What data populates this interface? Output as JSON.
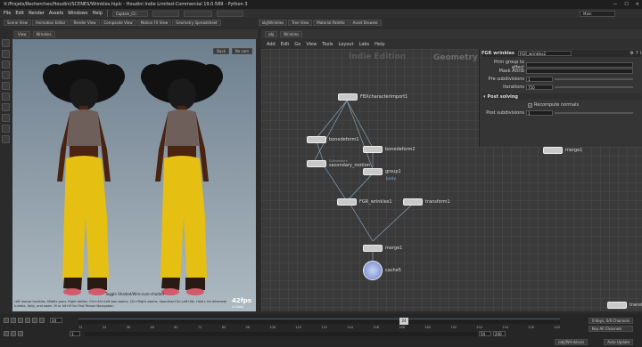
{
  "window": {
    "title": "V:/Projets/Recherches/Houdini/SCENES/Wrinkles.hiplc - Houdini Indie Limited-Commercial 19.0.589 - Python 3"
  },
  "menubar": {
    "items": [
      "File",
      "Edit",
      "Render",
      "Assets",
      "Windows",
      "Help"
    ],
    "desktop_field": "Captain_Ch",
    "desktop_right": "Main"
  },
  "pane_tabs_left": [
    "Scene View",
    "Animation Editor",
    "Render View",
    "Composite View",
    "Motion FX View",
    "Geometry Spreadsheet"
  ],
  "pane_tabs_right": [
    "obj/Wrinkles",
    "Tree View",
    "Material Palette",
    "Asset Browser"
  ],
  "viewport": {
    "tab": "View",
    "path": "Wrinkles",
    "camera": "Back",
    "view_mode": "No cam",
    "status": "Toggle Shaded/Wire-over-shaded",
    "fps": "42fps",
    "fps_sub": "4.54ms",
    "hint1": "Left mouse tumbles. Middle pans. Right dollies. Ctrl+Alt+Left box zooms. Ctrl+Right zooms. Spacebar-Ctrl-Left tilts. Hold L for alternate",
    "hint2": "tumble, dolly, and zoom.    M or Alt+M for First Person Navigation."
  },
  "network": {
    "path": "obj",
    "node": "Wrinkles",
    "menu": [
      "Add",
      "Edit",
      "Go",
      "View",
      "Tools",
      "Layout",
      "Labs",
      "Help"
    ],
    "watermark_left": "Indie Edition",
    "watermark_right": "Geometry",
    "nodes": [
      {
        "label": "FBXcharacterimport1"
      },
      {
        "label": "bonedeform1"
      },
      {
        "label": "bonedeform2"
      },
      {
        "label": "secondary_motion",
        "sub": "Subnetwork"
      },
      {
        "label": "group1",
        "sub": "body"
      },
      {
        "label": "FGR_wrinkles1"
      },
      {
        "label": "transform1"
      },
      {
        "label": "merge1"
      },
      {
        "label": "cache5"
      },
      {
        "label": "merge1"
      },
      {
        "label": "transf"
      }
    ]
  },
  "params": {
    "node_type": "FGR wrinkles",
    "node_name": "FGR_wrinkles2",
    "rows": [
      {
        "label": "Prim group to affect",
        "value": ""
      },
      {
        "label": "Mask Attrib",
        "value": ""
      },
      {
        "label": "Pre subdivisions",
        "value": "1"
      },
      {
        "label": "Iterations",
        "value": "750"
      }
    ],
    "section": "Post solving",
    "checkbox": "Recompute normals",
    "post_label": "Post subdivisions",
    "post_value": "1"
  },
  "timeline": {
    "frame": "24",
    "current": "24",
    "start": "1",
    "end_left": "54",
    "end_right": "240",
    "ticks": [
      "12",
      "24",
      "36",
      "48",
      "60",
      "72",
      "84",
      "96",
      "108",
      "120",
      "132",
      "144",
      "156",
      "168",
      "180",
      "192",
      "204",
      "216",
      "228",
      "240"
    ],
    "keys_label": "0 Keys, 0/0 Channels",
    "key_all": "Key All Channels",
    "status_path": "/obj/Wrinkles/s",
    "auto_update": "Auto Update"
  }
}
